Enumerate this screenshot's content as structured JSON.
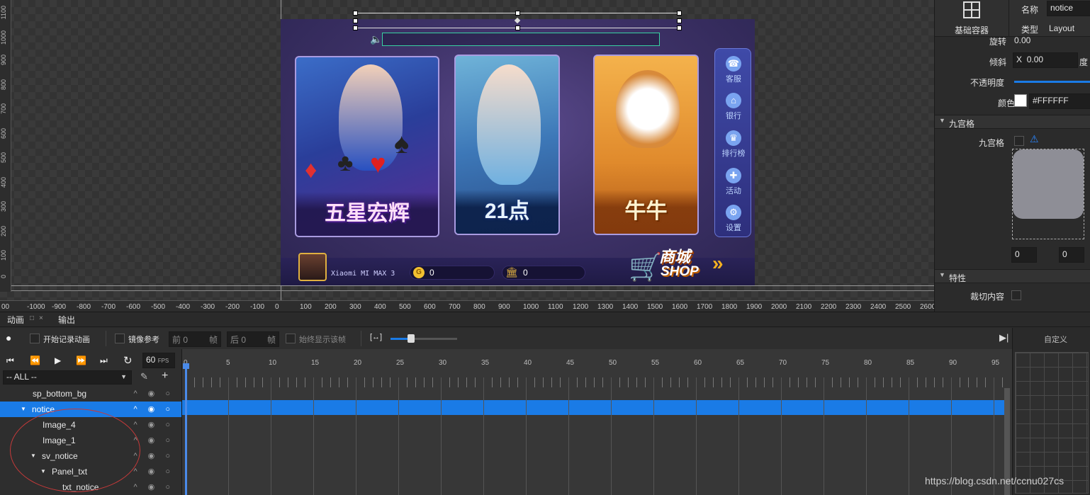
{
  "game": {
    "cards": [
      {
        "title": "五星宏辉"
      },
      {
        "title": "21点"
      },
      {
        "title": "牛牛"
      }
    ],
    "side_menu": [
      "客服",
      "银行",
      "排行榜",
      "活动",
      "设置"
    ],
    "player_name": "Xiaomi MI MAX 3",
    "gold": "0",
    "bank": "0",
    "shop_cn": "商城",
    "shop_en": "SHOP"
  },
  "rulers": {
    "vertical": [
      "1100",
      "1000",
      "900",
      "800",
      "700",
      "600",
      "500",
      "400",
      "300",
      "200",
      "100",
      "0"
    ],
    "horizontal": [
      "00",
      "-1000",
      "-900",
      "-800",
      "-700",
      "-600",
      "-500",
      "-400",
      "-300",
      "-200",
      "-100",
      "0",
      "100",
      "200",
      "300",
      "400",
      "500",
      "600",
      "700",
      "800",
      "900",
      "1000",
      "1100",
      "1200",
      "1300",
      "1400",
      "1500",
      "1600",
      "1700",
      "1800",
      "1900",
      "2000",
      "2100",
      "2200",
      "2300",
      "2400",
      "2500",
      "2600"
    ]
  },
  "inspector": {
    "component_label": "基础容器",
    "name_label": "名称",
    "name_value": "notice",
    "type_label": "类型",
    "type_value": "Layout",
    "rotation_label": "旋转",
    "rotation_value": "0.00",
    "skew_label": "倾斜",
    "skew_axis": "X",
    "skew_value": "0.00",
    "skew_unit": "度",
    "opacity_label": "不透明度",
    "color_label": "颜色",
    "color_value": "#FFFFFF",
    "nine_section": "九宫格",
    "nine_label": "九宫格",
    "nine_left": "0",
    "nine_right": "0",
    "props_section": "特性",
    "clip_label": "裁切内容"
  },
  "tabs": [
    "动画",
    "输出"
  ],
  "toolbar": {
    "record": "开始记录动画",
    "mirror": "镜像参考",
    "before_label": "前",
    "before_value": "0",
    "before_unit": "帧",
    "after_label": "后",
    "after_value": "0",
    "after_unit": "帧",
    "always_show": "始终显示该帧",
    "custom": "自定义"
  },
  "playback": {
    "fps_value": "60",
    "fps_unit": "FPS",
    "filter": "-- ALL --"
  },
  "timeline_ticks": [
    "0",
    "5",
    "10",
    "15",
    "20",
    "25",
    "30",
    "35",
    "40",
    "45",
    "50",
    "55",
    "60",
    "65",
    "70",
    "75",
    "80",
    "85",
    "90",
    "95"
  ],
  "layers": [
    {
      "name": "sp_bottom_bg",
      "indent": 0,
      "arrow": ""
    },
    {
      "name": "notice",
      "indent": 0,
      "arrow": "▼",
      "selected": true
    },
    {
      "name": "Image_4",
      "indent": 1,
      "arrow": ""
    },
    {
      "name": "Image_1",
      "indent": 1,
      "arrow": ""
    },
    {
      "name": "sv_notice",
      "indent": 1,
      "arrow": "▼"
    },
    {
      "name": "Panel_txt",
      "indent": 2,
      "arrow": "▼"
    },
    {
      "name": "txt_notice",
      "indent": 3,
      "arrow": ""
    }
  ],
  "watermark": "https://blog.csdn.net/ccnu027cs",
  "colors": {
    "accent": "#1a7be6",
    "notice_border": "#38d3a2",
    "annotation": "#c83a3a"
  }
}
